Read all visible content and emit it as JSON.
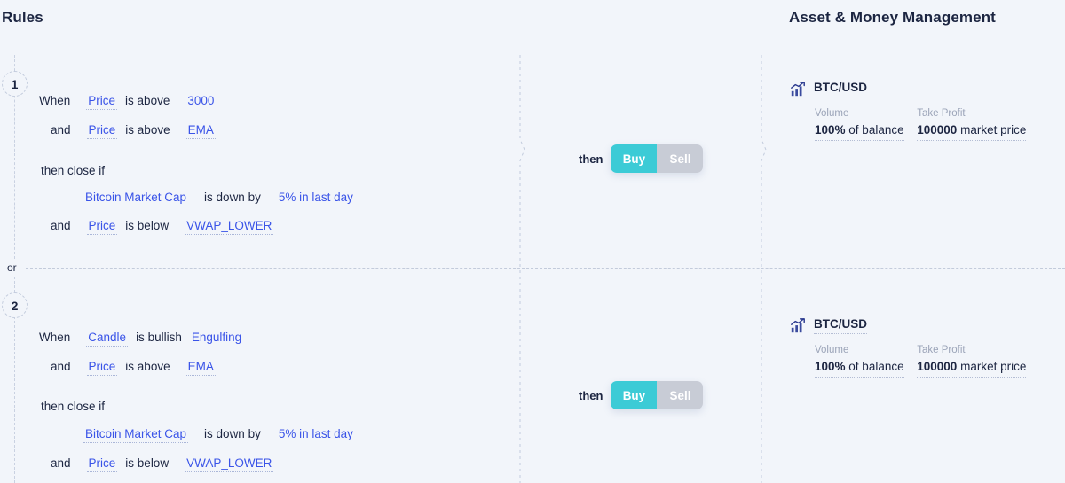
{
  "headers": {
    "rules": "Rules",
    "asset_money_management": "Asset & Money Management"
  },
  "separator": {
    "or_label": "or"
  },
  "colors": {
    "background": "#f2f5fa",
    "buy_active": "#3ccbd6",
    "sell_inactive": "#c8ccd6",
    "field_link": "#3a54e8",
    "text_dark": "#1c2541",
    "muted_label": "#9ba4b8",
    "dashed_line": "#c3ccdd"
  },
  "rules": [
    {
      "number": "1",
      "when_keyword": "When",
      "and_keyword": "and",
      "then_close_label": "then close if",
      "open_conditions": [
        {
          "prefix": "When",
          "field": "Price",
          "operator": "is above",
          "value": "3000",
          "value_underlined": false
        },
        {
          "prefix": "and",
          "field": "Price",
          "operator": "is above",
          "value": "EMA",
          "value_underlined": true
        }
      ],
      "close_conditions": [
        {
          "prefix": "",
          "field": "Bitcoin Market Cap",
          "operator": "is down by",
          "value": "5% in last day",
          "value_underlined": false
        },
        {
          "prefix": "and",
          "field": "Price",
          "operator": "is below",
          "value": "VWAP_LOWER",
          "value_underlined": true
        }
      ],
      "action": {
        "then_label": "then",
        "buy_label": "Buy",
        "sell_label": "Sell",
        "selected": "Buy"
      },
      "asset": {
        "icon": "chart-up-icon",
        "symbol": "BTC/USD",
        "volume_label": "Volume",
        "volume_amount": "100%",
        "volume_unit": "of balance",
        "take_profit_label": "Take Profit",
        "take_profit_amount": "100000",
        "take_profit_unit": "market price"
      }
    },
    {
      "number": "2",
      "when_keyword": "When",
      "and_keyword": "and",
      "then_close_label": "then close if",
      "open_conditions": [
        {
          "prefix": "When",
          "field": "Candle",
          "operator": "is bullish",
          "value": "Engulfing",
          "value_underlined": false
        },
        {
          "prefix": "and",
          "field": "Price",
          "operator": "is above",
          "value": "EMA",
          "value_underlined": true
        }
      ],
      "close_conditions": [
        {
          "prefix": "",
          "field": "Bitcoin Market Cap",
          "operator": "is down by",
          "value": "5% in last day",
          "value_underlined": false
        },
        {
          "prefix": "and",
          "field": "Price",
          "operator": "is below",
          "value": "VWAP_LOWER",
          "value_underlined": true
        }
      ],
      "action": {
        "then_label": "then",
        "buy_label": "Buy",
        "sell_label": "Sell",
        "selected": "Buy"
      },
      "asset": {
        "icon": "chart-up-icon",
        "symbol": "BTC/USD",
        "volume_label": "Volume",
        "volume_amount": "100%",
        "volume_unit": "of balance",
        "take_profit_label": "Take Profit",
        "take_profit_amount": "100000",
        "take_profit_unit": "market price"
      }
    }
  ]
}
